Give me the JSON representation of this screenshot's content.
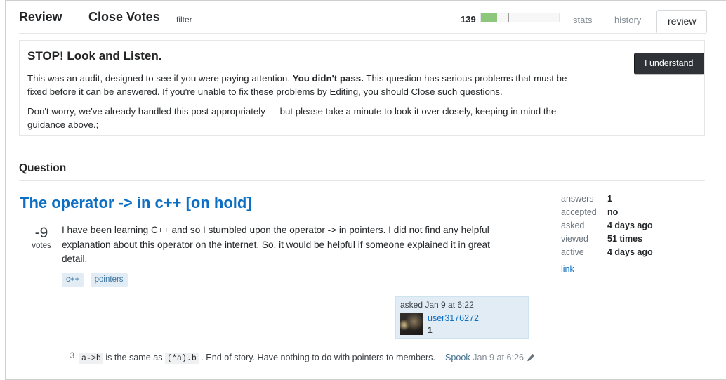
{
  "header": {
    "title": "Review",
    "subtitle": "Close Votes",
    "filter_label": "filter",
    "progress_count": "139",
    "progress_fill_percent": 21,
    "progress_tick_percent": 35,
    "tabs": [
      {
        "label": "stats",
        "active": false
      },
      {
        "label": "history",
        "active": false
      },
      {
        "label": "review",
        "active": true
      }
    ],
    "accent_color": "#8dc77b"
  },
  "notice": {
    "title": "STOP! Look and Listen.",
    "paragraph1_part1": "This was an audit, designed to see if you were paying attention. ",
    "paragraph1_bold": "You didn't pass.",
    "paragraph1_part2": " This question has serious problems that must be fixed before it can be answered. If you're unable to fix these problems by Editing, you should Close such questions.",
    "paragraph2": "Don't worry, we've already handled this post appropriately — but please take a minute to look it over closely, keeping in mind the guidance above.;",
    "button_label": "I understand"
  },
  "section": {
    "heading": "Question"
  },
  "question": {
    "title": "The operator -> in c++ [on hold]",
    "votes": "-9",
    "votes_label": "votes",
    "body": "I have been learning C++ and so I stumbled upon the operator -> in pointers. I did not find any helpful explanation about this operator on the internet. So, it would be helpful if someone explained it in great detail.",
    "tags": [
      "c++",
      "pointers"
    ],
    "link_color": "#0d6fc4"
  },
  "user_card": {
    "action": "asked Jan 9 at 6:22",
    "username": "user3176272",
    "reputation": "1"
  },
  "stats": {
    "rows": [
      {
        "key": "answers",
        "value": "1"
      },
      {
        "key": "accepted",
        "value": "no"
      },
      {
        "key": "asked",
        "value": "4 days ago"
      },
      {
        "key": "viewed",
        "value": "51 times"
      },
      {
        "key": "active",
        "value": "4 days ago"
      }
    ],
    "link_label": "link"
  },
  "comment": {
    "score": "3",
    "code1": "a->b",
    "text1": " is the same as ",
    "code2": "(*a).b",
    "text2": " . End of story. Have nothing to do with pointers to members. – ",
    "username": "Spook",
    "date": " Jan 9 at 6:26",
    "edit_icon": "pencil-icon"
  }
}
